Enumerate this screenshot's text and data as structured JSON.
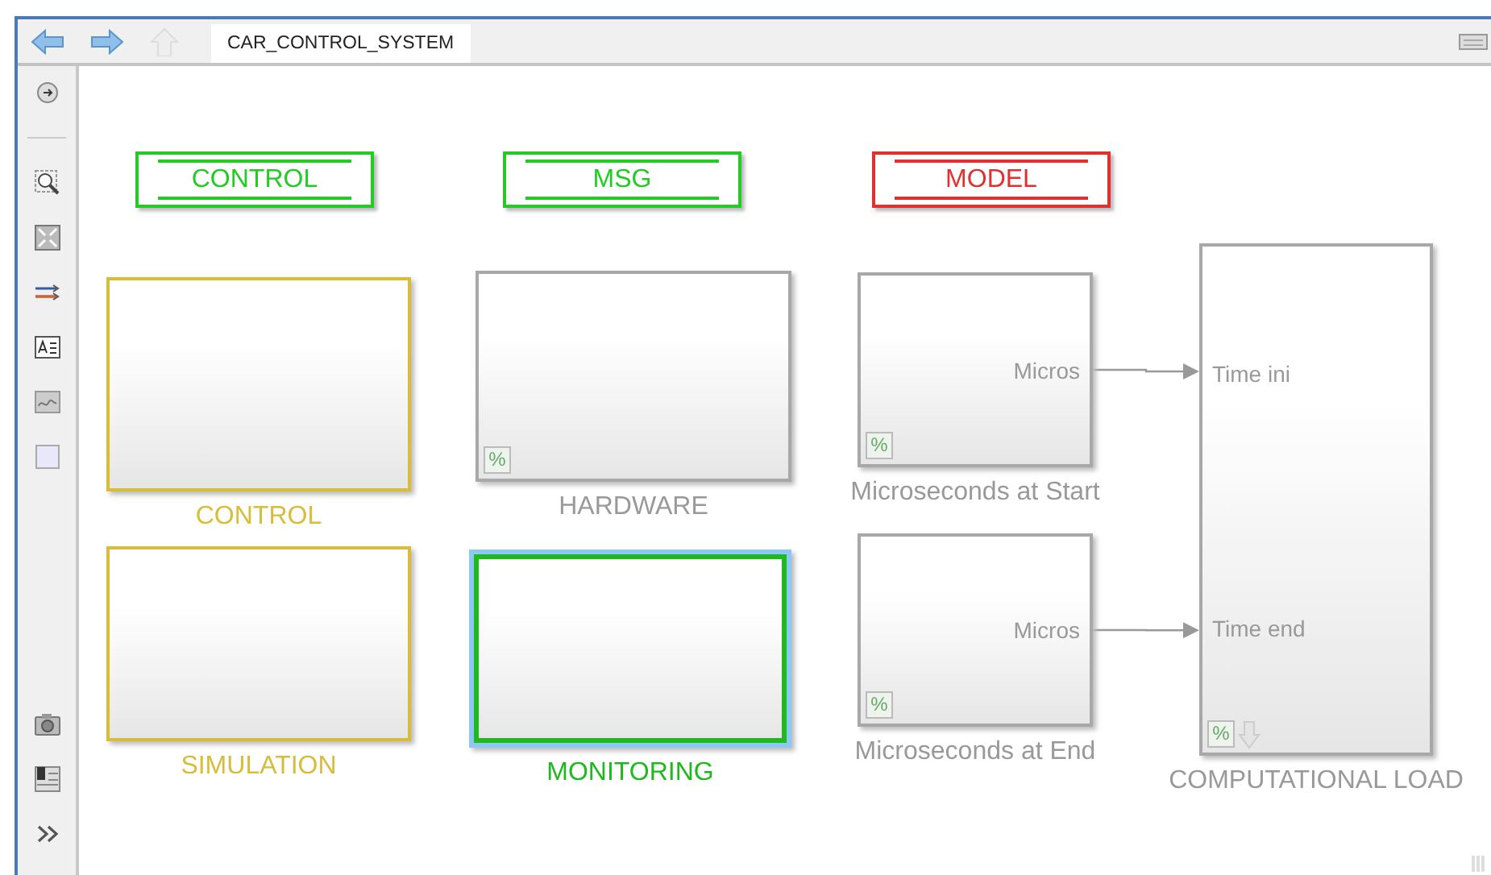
{
  "toolbar": {
    "nav_buttons": [
      {
        "kind": "back",
        "disabled": false
      },
      {
        "kind": "forward",
        "disabled": false
      },
      {
        "kind": "up",
        "disabled": true
      }
    ],
    "breadcrumb": "CAR_CONTROL_SYSTEM"
  },
  "tags": [
    {
      "label": "CONTROL",
      "color": "#22cc22"
    },
    {
      "label": "MSG",
      "color": "#22cc22"
    },
    {
      "label": "MODEL",
      "color": "#e03030"
    }
  ],
  "blocks": [
    {
      "label": "CONTROL",
      "kind": "subsystem",
      "color": "#d8bc3c",
      "selected": false
    },
    {
      "label": "SIMULATION",
      "kind": "subsystem",
      "color": "#d8bc3c",
      "selected": false
    },
    {
      "label": "HARDWARE",
      "kind": "linked",
      "badge": "%",
      "color": "#a8a8a8",
      "selected": false
    },
    {
      "label": "MONITORING",
      "kind": "subsystem",
      "color": "#1fb81f",
      "selected": true
    },
    {
      "label": "Microseconds at Start",
      "kind": "linked",
      "badge": "%",
      "color": "#a8a8a8",
      "selected": false,
      "outputs": [
        "Micros"
      ]
    },
    {
      "label": "Microseconds at End",
      "kind": "linked",
      "badge": "%",
      "color": "#a8a8a8",
      "selected": false,
      "outputs": [
        "Micros"
      ]
    },
    {
      "label": "COMPUTATIONAL LOAD",
      "kind": "linked_arrow",
      "badge": "%",
      "color": "#a8a8a8",
      "selected": false,
      "inputs": [
        "Time ini",
        "Time end"
      ]
    }
  ]
}
